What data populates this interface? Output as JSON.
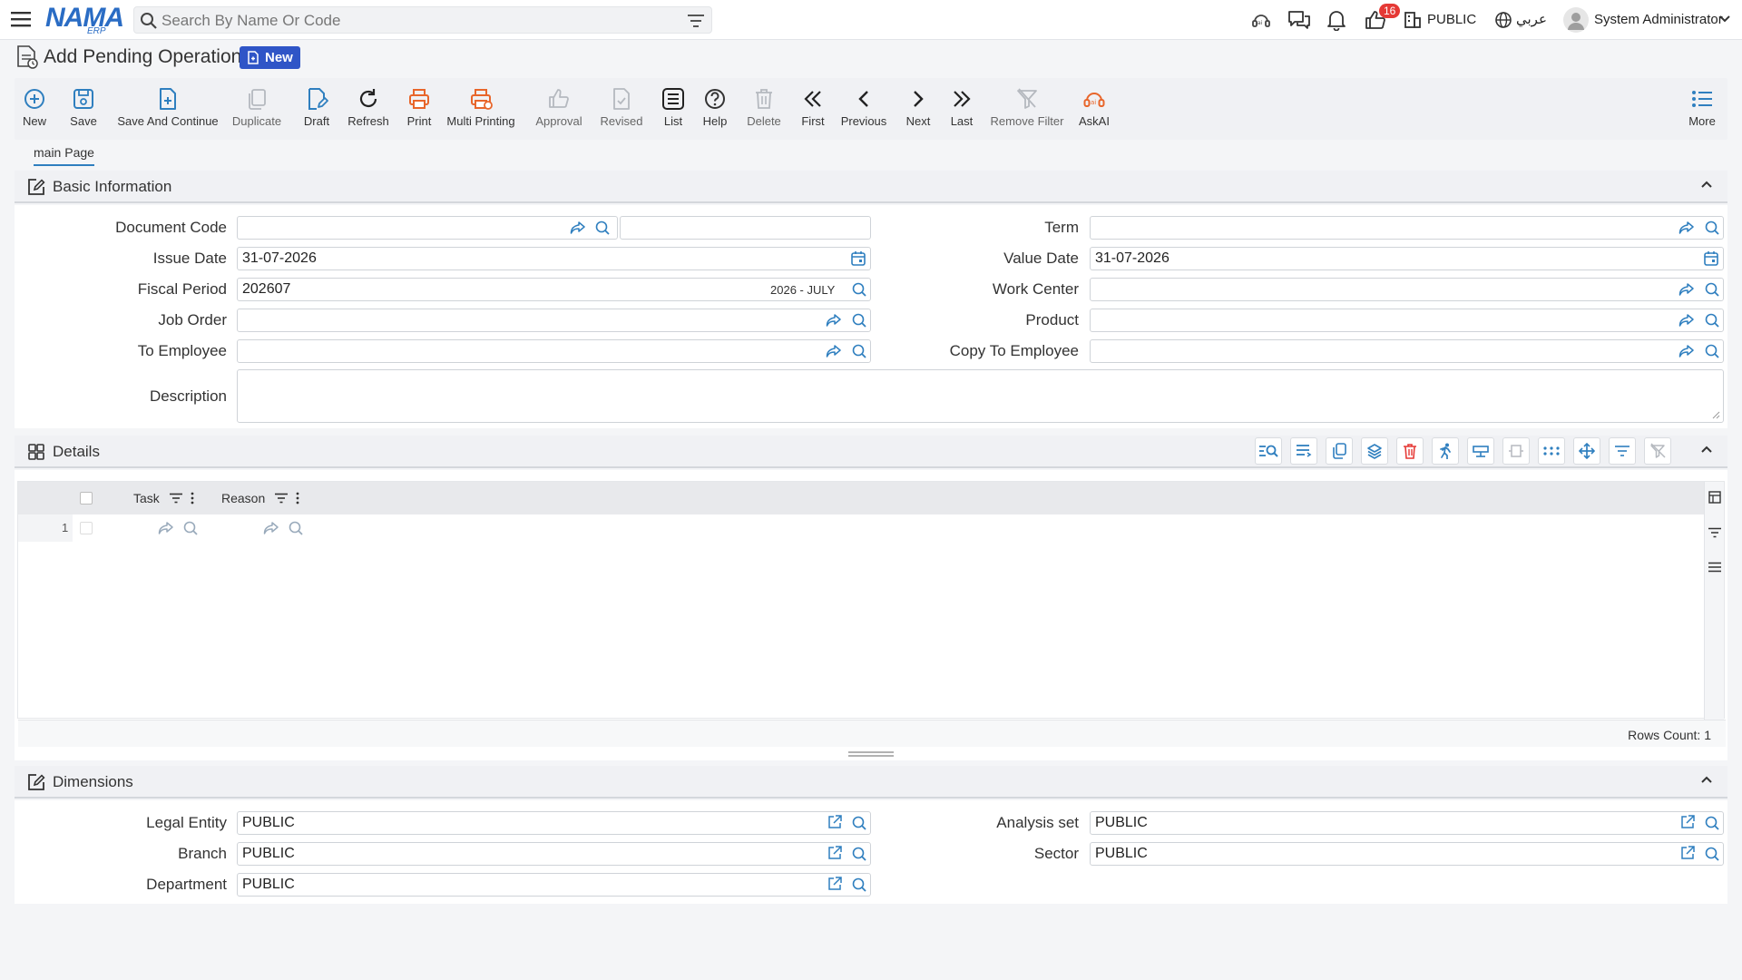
{
  "topbar": {
    "logo_main": "NAMA",
    "logo_sub": "ERP",
    "search_placeholder": "Search By Name Or Code",
    "notif_count": "16",
    "entity": "PUBLIC",
    "language": "عربي",
    "user": "System Administrator"
  },
  "page": {
    "title": "Add Pending Operation",
    "badge": "New"
  },
  "toolbar": {
    "new": "New",
    "save": "Save",
    "save_continue": "Save And Continue",
    "duplicate": "Duplicate",
    "draft": "Draft",
    "refresh": "Refresh",
    "print": "Print",
    "multi_printing": "Multi Printing",
    "approval": "Approval",
    "revised": "Revised",
    "list": "List",
    "help": "Help",
    "delete": "Delete",
    "first": "First",
    "previous": "Previous",
    "next": "Next",
    "last": "Last",
    "remove_filter": "Remove Filter",
    "askai": "AskAI",
    "more": "More"
  },
  "tabs": {
    "main": "main Page"
  },
  "basic": {
    "title": "Basic Information",
    "document_code_label": "Document Code",
    "document_code": "",
    "term_label": "Term",
    "issue_date_label": "Issue Date",
    "issue_date": "31-07-2026",
    "value_date_label": "Value Date",
    "value_date": "31-07-2026",
    "fiscal_period_label": "Fiscal Period",
    "fiscal_period": "202607",
    "fiscal_period_name": "2026 - JULY",
    "work_center_label": "Work Center",
    "job_order_label": "Job Order",
    "product_label": "Product",
    "to_employee_label": "To Employee",
    "copy_to_employee_label": "Copy To Employee",
    "description_label": "Description"
  },
  "details": {
    "title": "Details",
    "columns": [
      "Task",
      "Reason"
    ],
    "row_number": "1",
    "rows_count_label": "Rows Count: 1"
  },
  "dimensions": {
    "title": "Dimensions",
    "legal_entity_label": "Legal Entity",
    "legal_entity": "PUBLIC",
    "analysis_set_label": "Analysis set",
    "analysis_set": "PUBLIC",
    "branch_label": "Branch",
    "branch": "PUBLIC",
    "sector_label": "Sector",
    "sector": "PUBLIC",
    "department_label": "Department",
    "department": "PUBLIC"
  },
  "colors": {
    "accent": "#2f7fbf",
    "primary": "#2f55c7",
    "print": "#e8662b",
    "danger": "#e53935"
  }
}
